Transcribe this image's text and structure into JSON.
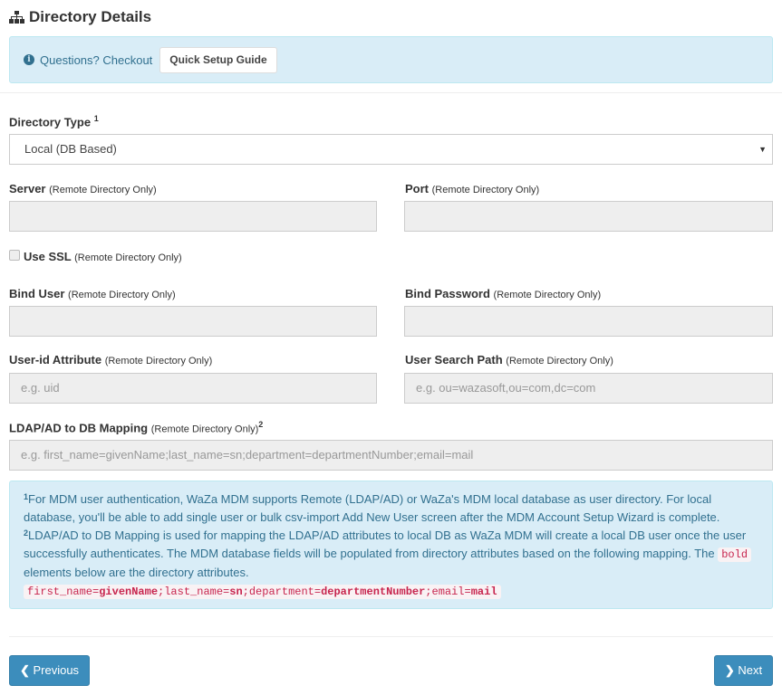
{
  "header": {
    "title": "Directory Details",
    "icon": "sitemap-icon"
  },
  "alert": {
    "text": "Questions? Checkout",
    "button": "Quick Setup Guide"
  },
  "form": {
    "directory_type": {
      "label": "Directory Type",
      "sup": "1",
      "value": "Local (DB Based)"
    },
    "remote_only": "(Remote Directory Only)",
    "server": {
      "label": "Server",
      "value": ""
    },
    "port": {
      "label": "Port",
      "value": ""
    },
    "use_ssl": {
      "label": "Use SSL",
      "checked": false
    },
    "bind_user": {
      "label": "Bind User",
      "value": ""
    },
    "bind_password": {
      "label": "Bind Password",
      "value": ""
    },
    "user_id_attribute": {
      "label": "User-id Attribute",
      "placeholder": "e.g. uid"
    },
    "user_search_path": {
      "label": "User Search Path",
      "placeholder": "e.g. ou=wazasoft,ou=com,dc=com"
    },
    "mapping": {
      "label": "LDAP/AD to DB Mapping",
      "sup": "2",
      "placeholder": "e.g. first_name=givenName;last_name=sn;department=departmentNumber;email=mail"
    }
  },
  "note": {
    "sup1": "1",
    "text1": "For MDM user authentication, WaZa MDM supports Remote (LDAP/AD) or WaZa's MDM local database as user directory. For local database, you'll be able to add single user or bulk csv-import Add New User screen after the MDM Account Setup Wizard is complete.",
    "sup2": "2",
    "text2": "LDAP/AD to DB Mapping is used for mapping the LDAP/AD attributes to local DB as WaZa MDM will create a local DB user once the user successfully authenticates. The MDM database fields will be populated from directory attributes based on the following mapping. The",
    "bold_code": "bold",
    "text3": "elements below are the directory attributes.",
    "mapping_code": [
      [
        "first_name=",
        "givenName"
      ],
      [
        ";last_name=",
        "sn"
      ],
      [
        ";department=",
        "departmentNumber"
      ],
      [
        ";email=",
        "mail"
      ]
    ]
  },
  "nav": {
    "previous": "Previous",
    "next": "Next"
  },
  "colors": {
    "info_bg": "#d9edf7",
    "info_text": "#31708f",
    "primary": "#3c8dbc"
  }
}
